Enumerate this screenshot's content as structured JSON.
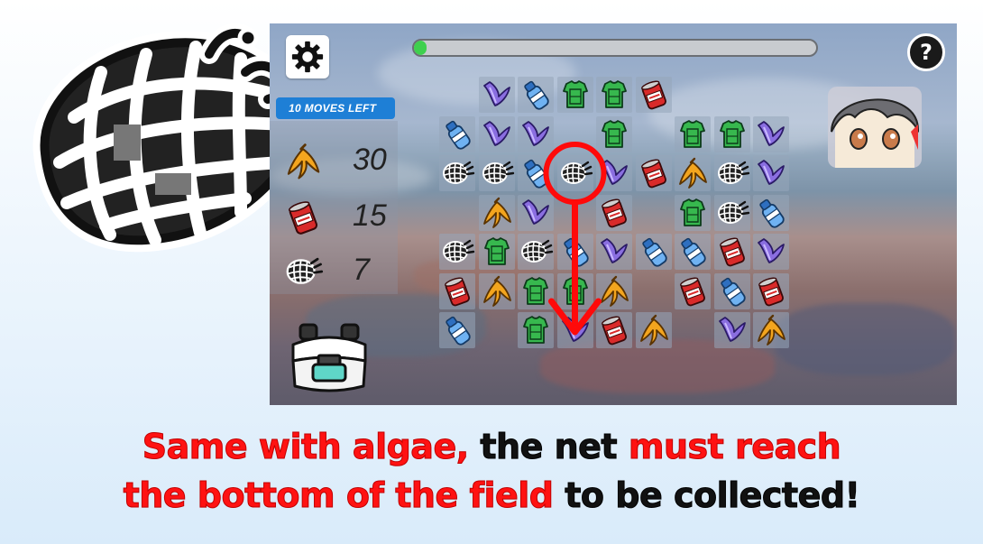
{
  "hud": {
    "moves_left": "10 MOVES LEFT",
    "help_label": "?",
    "progress_fraction": 0.02,
    "settings_icon": "gear-icon"
  },
  "goals": [
    {
      "item": "banana-peel",
      "icon": "banana-peel-icon",
      "count": "30"
    },
    {
      "item": "soda-can",
      "icon": "soda-can-icon",
      "count": "15"
    },
    {
      "item": "net",
      "icon": "net-icon",
      "count": "7"
    }
  ],
  "board": {
    "rows": 7,
    "cols": 9,
    "cells": [
      [
        "",
        "algae",
        "bottle",
        "jersey",
        "jersey",
        "can",
        "",
        "",
        ""
      ],
      [
        "bottle",
        "algae",
        "algae",
        "",
        "jersey",
        "",
        "jersey",
        "jersey",
        "algae"
      ],
      [
        "net",
        "net",
        "bottle",
        "net",
        "algae",
        "can",
        "banana",
        "net",
        "algae"
      ],
      [
        "",
        "banana",
        "algae",
        "",
        "can",
        "",
        "jersey",
        "net",
        "bottle"
      ],
      [
        "net",
        "jersey",
        "net",
        "bottle",
        "algae",
        "bottle",
        "bottle",
        "can",
        "algae"
      ],
      [
        "can",
        "banana",
        "jersey",
        "jersey",
        "banana",
        "",
        "can",
        "bottle",
        "can"
      ],
      [
        "bottle",
        "",
        "jersey",
        "algae",
        "can",
        "banana",
        "",
        "algae",
        "banana"
      ]
    ],
    "highlight": {
      "row": 2,
      "col": 3,
      "arrow_to_row": 6
    }
  },
  "caption": {
    "line1": [
      {
        "text": "Same with algae, ",
        "color": "red"
      },
      {
        "text": "the net ",
        "color": "black"
      },
      {
        "text": "must reach",
        "color": "red"
      }
    ],
    "line2": [
      {
        "text": "the bottom of the field ",
        "color": "red"
      },
      {
        "text": "to be collected!",
        "color": "black"
      }
    ]
  },
  "colors": {
    "caption_red": "#ff1212",
    "moves_badge": "#1e7fd6",
    "progress_fill": "#3ed04e",
    "highlight": "#ff0a0a"
  }
}
